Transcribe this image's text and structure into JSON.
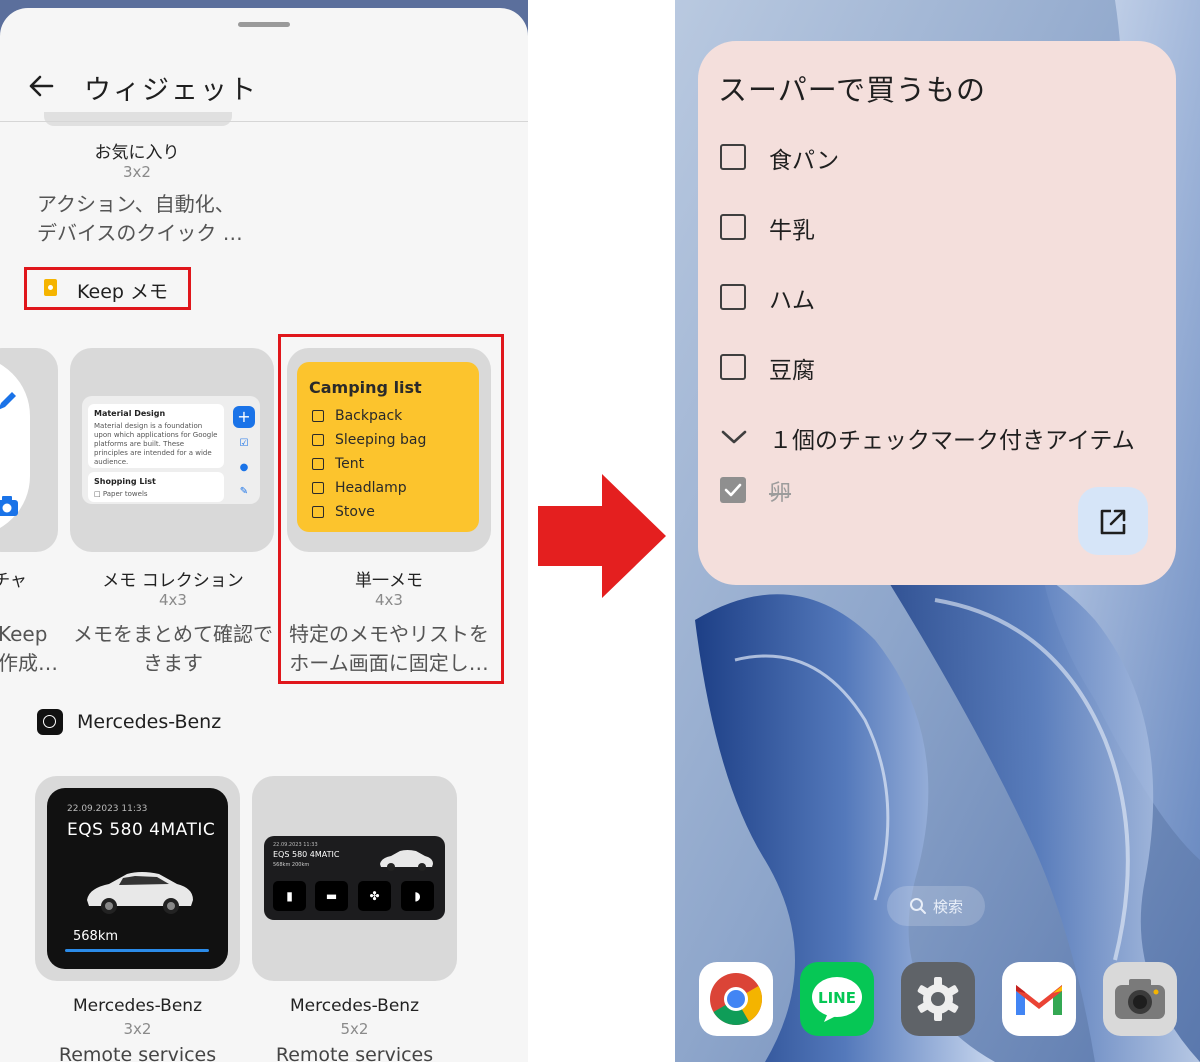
{
  "widget_picker": {
    "title": "ウィジェット",
    "favorites": {
      "name": "お気に入り",
      "size": "3x2",
      "desc_line1": "アクション、自動化、",
      "desc_line2": "デバイスのクイック …"
    },
    "keep_section": {
      "app_name": "Keep メモ",
      "highlight_color": "#e0161b",
      "widgets": [
        {
          "name": "チャ",
          "desc_line1": "Keep",
          "desc_line2": "作成…"
        },
        {
          "name": "メモ コレクション",
          "size": "4x3",
          "desc_line1": "メモをまとめて確認で",
          "desc_line2": "きます",
          "preview": {
            "note1_title": "Material Design",
            "note1_body": "Material design is a foundation upon which applications for Google platforms are built. These principles are intended for a wide audience.",
            "note2_title": "Shopping List",
            "note2_item": "Paper towels"
          }
        },
        {
          "name": "単一メモ",
          "size": "4x3",
          "desc_line1": "特定のメモやリストを",
          "desc_line2": "ホーム画面に固定し…",
          "preview": {
            "title": "Camping list",
            "items": [
              "Backpack",
              "Sleeping bag",
              "Tent",
              "Headlamp",
              "Stove"
            ],
            "color": "#fcc42d"
          }
        }
      ]
    },
    "mercedes_section": {
      "app_name": "Mercedes-Benz",
      "widgets": [
        {
          "name": "Mercedes-Benz",
          "size": "3x2",
          "desc": "Remote services",
          "preview": {
            "date": "22.09.2023  11:33",
            "model": "EQS 580 4MATIC",
            "range": "568km"
          }
        },
        {
          "name": "Mercedes-Benz",
          "size": "5x2",
          "desc": "Remote services",
          "preview": {
            "date": "22.09.2023  11:33",
            "model": "EQS 580 4MATIC",
            "range_text": "568km    200km"
          }
        }
      ]
    }
  },
  "home_screen": {
    "note_widget": {
      "title": "スーパーで買うもの",
      "items": [
        "食パン",
        "牛乳",
        "ハム",
        "豆腐"
      ],
      "checked_summary": "１個のチェックマーク付きアイテム",
      "checked_items": [
        "卵"
      ],
      "background": "#f4dfdc"
    },
    "search_label": "検索",
    "dock_apps": [
      {
        "name": "Chrome",
        "icon": "chrome-icon"
      },
      {
        "name": "LINE",
        "icon": "line-icon",
        "label": "LINE"
      },
      {
        "name": "Settings",
        "icon": "gear-icon"
      },
      {
        "name": "Gmail",
        "icon": "gmail-icon"
      },
      {
        "name": "Camera",
        "icon": "camera-icon"
      }
    ]
  }
}
